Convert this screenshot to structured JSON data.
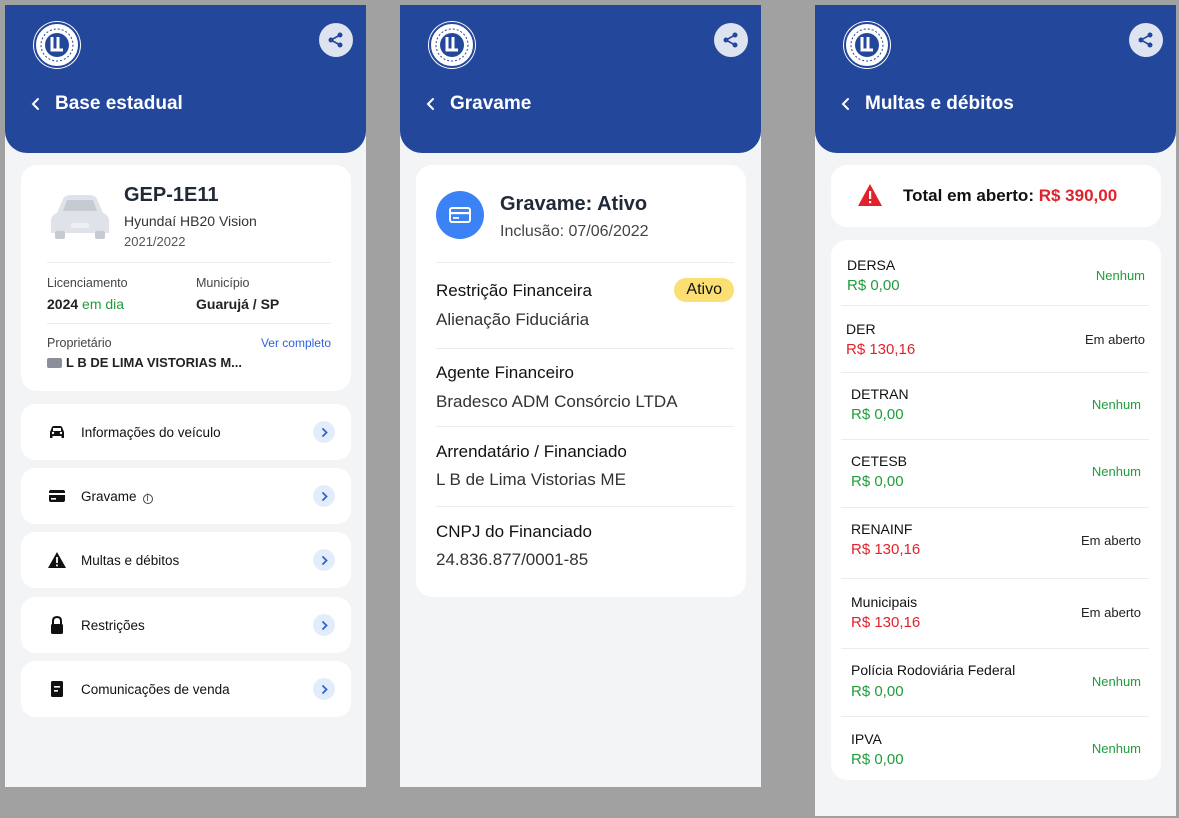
{
  "screens": [
    {
      "title": "Base estadual",
      "vehicle": {
        "plate": "GEP-1E11",
        "model": "Hyundaí HB20 Vision",
        "year": "2021/2022",
        "licensing_label": "Licenciamento",
        "licensing_year": "2024",
        "licensing_status": "em dia",
        "city_label": "Município",
        "city_value": "Guarujá / SP",
        "owner_label": "Proprietário",
        "owner_link": "Ver completo",
        "owner_value": "L B DE LIMA VISTORIAS M..."
      },
      "menu": [
        {
          "label": "Informações do veículo",
          "icon": "car-icon"
        },
        {
          "label": "Gravame",
          "icon": "card-icon",
          "info": "i"
        },
        {
          "label": "Multas e débitos",
          "icon": "warning-icon"
        },
        {
          "label": "Restrições",
          "icon": "lock-icon"
        },
        {
          "label": "Comunicações de venda",
          "icon": "document-icon"
        }
      ]
    },
    {
      "title": "Gravame",
      "status_title": "Gravame: Ativo",
      "inclusion": "Inclusão: 07/06/2022",
      "sections": [
        {
          "heading": "Restrição Financeira",
          "value": "Alienação Fiduciária",
          "badge": "Ativo"
        },
        {
          "heading": "Agente Financeiro",
          "value": "Bradesco ADM Consórcio LTDA"
        },
        {
          "heading": "Arrendatário / Financiado",
          "value": "L B de Lima Vistorias ME"
        },
        {
          "heading": "CNPJ do Financiado",
          "value": "24.836.877/0001-85"
        }
      ]
    },
    {
      "title": "Multas e débitos",
      "total_label": "Total em aberto:",
      "total_value": "R$ 390,00",
      "items": [
        {
          "name": "DERSA",
          "amount": "R$ 0,00",
          "status": "Nenhum"
        },
        {
          "name": "DER",
          "amount": "R$ 130,16",
          "status": "Em aberto"
        },
        {
          "name": "DETRAN",
          "amount": "R$ 0,00",
          "status": "Nenhum"
        },
        {
          "name": "CETESB",
          "amount": "R$ 0,00",
          "status": "Nenhum"
        },
        {
          "name": "RENAINF",
          "amount": "R$ 130,16",
          "status": "Em aberto"
        },
        {
          "name": "Municipais",
          "amount": "R$ 130,16",
          "status": "Em aberto"
        },
        {
          "name": "Polícia Rodoviária Federal",
          "amount": "R$ 0,00",
          "status": "Nenhum"
        },
        {
          "name": "IPVA",
          "amount": "R$ 0,00",
          "status": "Nenhum"
        }
      ]
    }
  ],
  "colors": {
    "header": "#23479a",
    "accent_blue": "#3b82f6",
    "green": "#1f9d3a",
    "red": "#e0222c",
    "badge_yellow": "#fbdf72"
  }
}
